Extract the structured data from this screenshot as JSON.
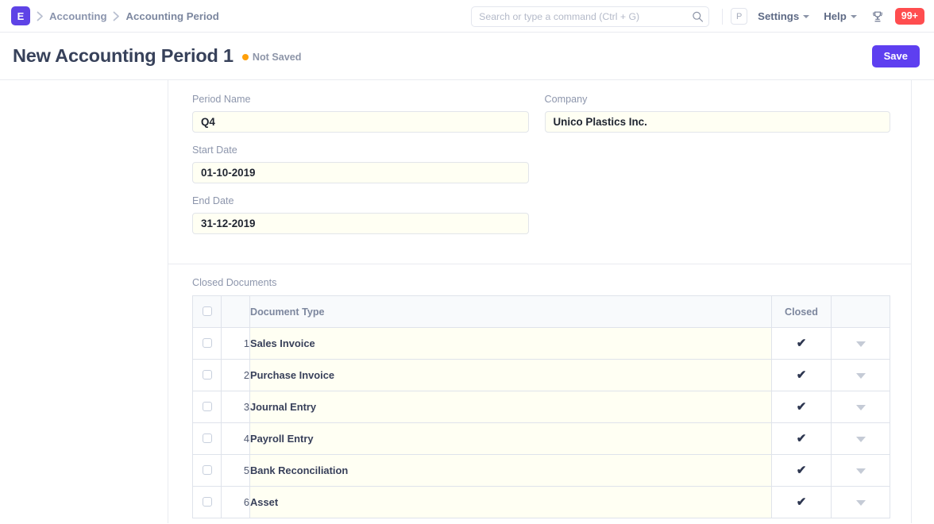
{
  "navbar": {
    "logo_text": "E",
    "logo_color": "#5e43e6",
    "breadcrumb": [
      {
        "label": "Accounting"
      },
      {
        "label": "Accounting Period"
      }
    ],
    "search": {
      "placeholder": "Search or type a command (Ctrl + G)",
      "value": "",
      "icon": "search-icon"
    },
    "avatar_initial": "P",
    "menus": [
      {
        "label": "Settings",
        "icon": "chevron-down-icon"
      },
      {
        "label": "Help",
        "icon": "chevron-down-icon"
      }
    ],
    "trophy_icon": "trophy-icon",
    "notification_badge": "99+",
    "notification_color": "#ff4d4f"
  },
  "page_head": {
    "title": "New Accounting Period 1",
    "status_text": "Not Saved",
    "status_dot_color": "#ffa00a",
    "save_label": "Save",
    "save_color": "#5e3ff0"
  },
  "form": {
    "left_fields": [
      {
        "label": "Period Name",
        "value": "Q4",
        "placeholder": ""
      },
      {
        "label": "Start Date",
        "value": "01-10-2019",
        "placeholder": ""
      },
      {
        "label": "End Date",
        "value": "31-12-2019",
        "placeholder": ""
      }
    ],
    "right_fields": [
      {
        "label": "Company",
        "value": "Unico Plastics Inc.",
        "placeholder": ""
      }
    ]
  },
  "table": {
    "section_label": "Closed Documents",
    "columns": {
      "select_all": "",
      "index": "",
      "document_type": "Document Type",
      "closed": "Closed",
      "actions": ""
    },
    "rows": [
      {
        "index": "1",
        "document_type": "Sales Invoice",
        "closed": "✔",
        "action_icon": "caret-down-icon"
      },
      {
        "index": "2",
        "document_type": "Purchase Invoice",
        "closed": "✔",
        "action_icon": "caret-down-icon"
      },
      {
        "index": "3",
        "document_type": "Journal Entry",
        "closed": "✔",
        "action_icon": "caret-down-icon"
      },
      {
        "index": "4",
        "document_type": "Payroll Entry",
        "closed": "✔",
        "action_icon": "caret-down-icon"
      },
      {
        "index": "5",
        "document_type": "Bank Reconciliation",
        "closed": "✔",
        "action_icon": "caret-down-icon"
      },
      {
        "index": "6",
        "document_type": "Asset",
        "closed": "✔",
        "action_icon": "caret-down-icon"
      }
    ]
  }
}
